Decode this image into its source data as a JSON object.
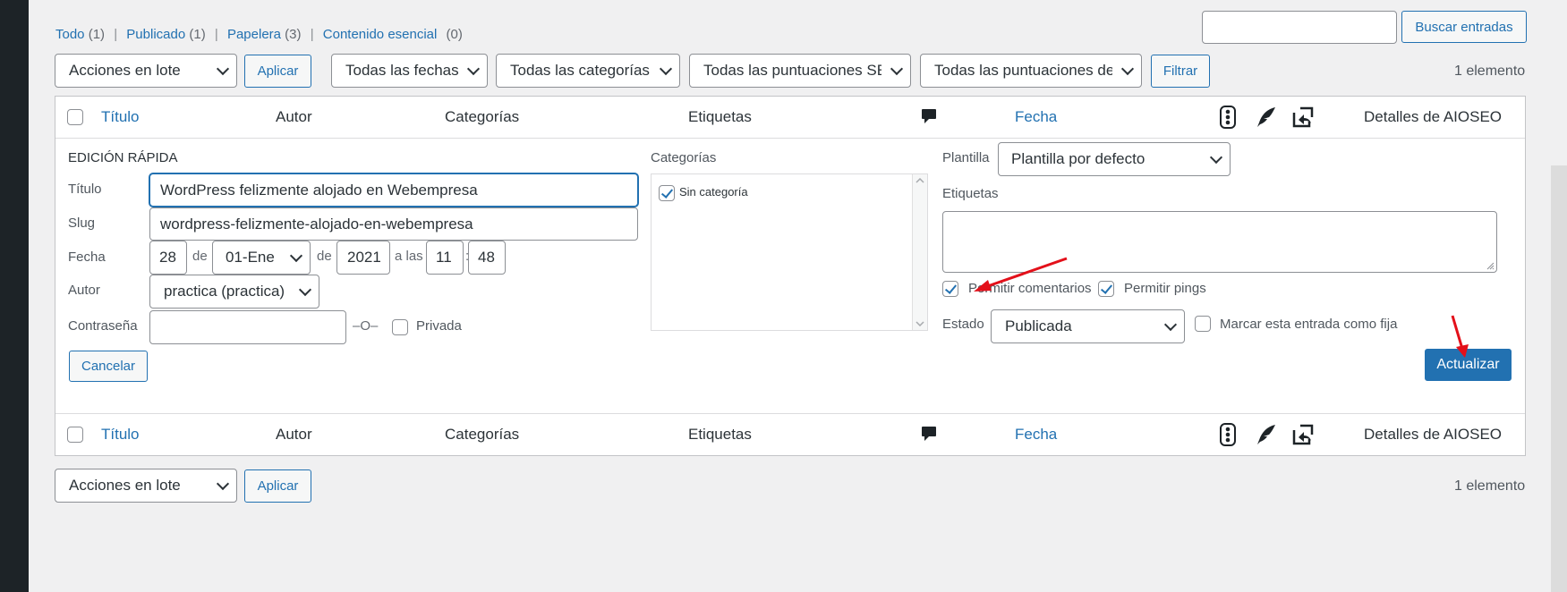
{
  "filters": {
    "views": [
      {
        "label": "Todo",
        "count": "(1)"
      },
      {
        "label": "Publicado",
        "count": "(1)"
      },
      {
        "label": "Papelera",
        "count": "(3)"
      },
      {
        "label": "Contenido esencial",
        "count": "(0)"
      }
    ],
    "search_button": "Buscar entradas",
    "search_value": "",
    "bulk_actions": "Acciones en lote",
    "apply": "Aplicar",
    "date_filter": "Todas las fechas",
    "category_filter": "Todas las categorías",
    "seo_score_filter": "Todas las puntuaciones SEO",
    "readability_filter": "Todas las puntuaciones de",
    "filter_button": "Filtrar",
    "items_count": "1 elemento"
  },
  "columns": {
    "title": "Título",
    "author": "Autor",
    "categories": "Categorías",
    "tags": "Etiquetas",
    "date": "Fecha",
    "aioseo": "Detalles de AIOSEO",
    "icons": [
      "comments-icon",
      "seo-traffic-light-icon",
      "readability-feather-icon",
      "links-icon"
    ]
  },
  "quick_edit": {
    "heading": "EDICIÓN RÁPIDA",
    "title_label": "Título",
    "title_value": "WordPress felizmente alojado en Webempresa",
    "slug_label": "Slug",
    "slug_value": "wordpress-felizmente-alojado-en-webempresa",
    "date_label": "Fecha",
    "day": "28",
    "de1": "de",
    "month": "01-Ene",
    "de2": "de",
    "year": "2021",
    "at": "a las",
    "hour": "11",
    "colon": ":",
    "minute": "48",
    "author_label": "Autor",
    "author_value": "practica (practica)",
    "password_label": "Contraseña",
    "password_value": "",
    "or_sep": "–O–",
    "private_label": "Privada",
    "cancel": "Cancelar",
    "categories_label": "Categorías",
    "category_item": "Sin categoría",
    "template_label": "Plantilla",
    "template_value": "Plantilla por defecto",
    "tags_label": "Etiquetas",
    "tags_value": "",
    "allow_comments": "Permitir comentarios",
    "allow_pings": "Permitir pings",
    "status_label": "Estado",
    "status_value": "Publicada",
    "sticky_label": "Marcar esta entrada como fija",
    "update": "Actualizar"
  },
  "colors": {
    "accent": "#2271b1",
    "annotation": "#e3101a"
  }
}
